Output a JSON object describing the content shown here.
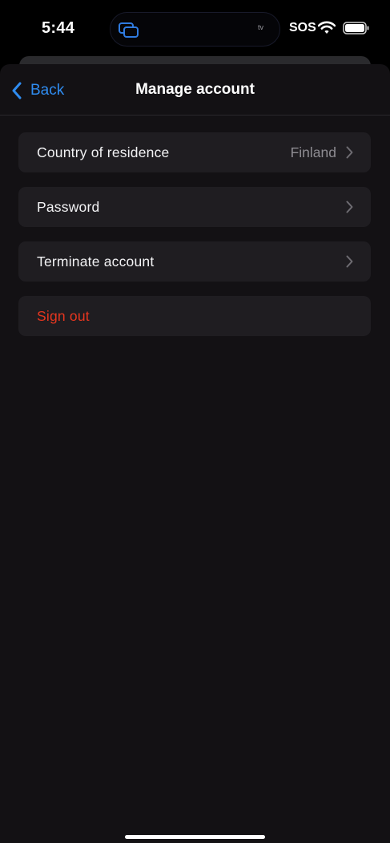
{
  "status_bar": {
    "time": "5:44",
    "sos": "SOS",
    "island_label": "tv"
  },
  "nav": {
    "back_label": "Back",
    "title": "Manage account"
  },
  "rows": [
    {
      "label": "Country of residence",
      "value": "Finland",
      "style": "default"
    },
    {
      "label": "Password",
      "value": "",
      "style": "default"
    },
    {
      "label": "Terminate account",
      "value": "",
      "style": "default"
    },
    {
      "label": "Sign out",
      "value": "",
      "style": "destructive"
    }
  ],
  "colors": {
    "accent": "#2f8cf0",
    "destructive": "#e5361f",
    "background": "#131114",
    "row_background": "#1f1d21",
    "secondary_text": "#8e8c92"
  },
  "icons": [
    "back-chevron-icon",
    "chevron-right-icon",
    "wifi-icon",
    "battery-icon",
    "screen-mirroring-icon"
  ]
}
